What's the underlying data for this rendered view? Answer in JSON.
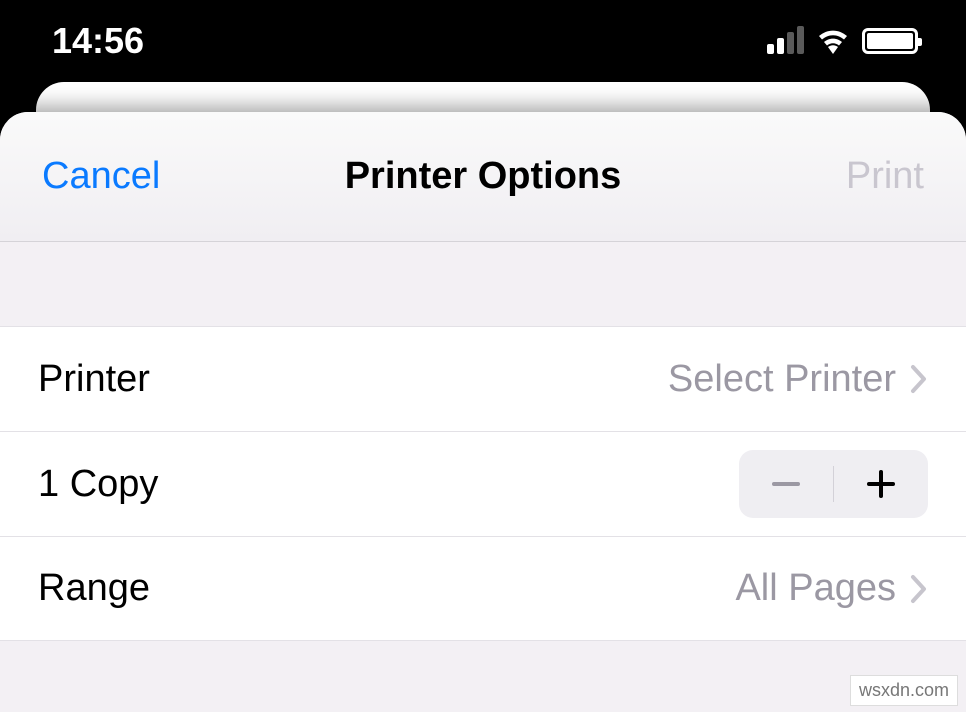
{
  "status_bar": {
    "time": "14:56"
  },
  "nav": {
    "cancel_label": "Cancel",
    "title": "Printer Options",
    "print_label": "Print"
  },
  "rows": {
    "printer": {
      "label": "Printer",
      "value": "Select Printer"
    },
    "copies": {
      "label": "1 Copy"
    },
    "range": {
      "label": "Range",
      "value": "All Pages"
    }
  },
  "watermark": "wsxdn.com"
}
